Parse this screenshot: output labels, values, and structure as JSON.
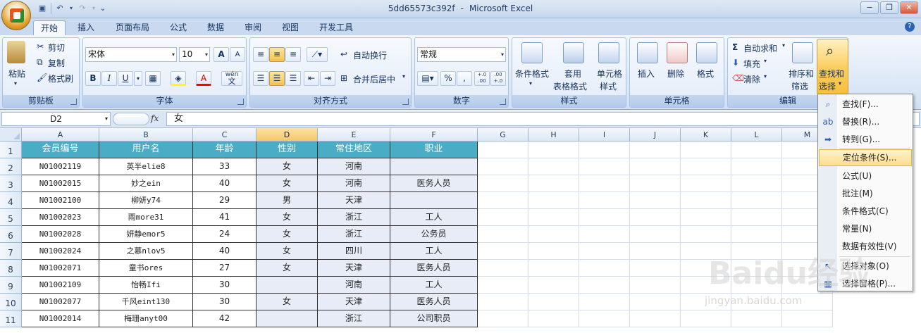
{
  "window": {
    "title": "5dd65573c392f - Microsoft Excel",
    "title_file": "5dd65573c392f",
    "title_sep": "-",
    "title_app": "Microsoft Excel",
    "min": "−",
    "max": "❐",
    "close": "✕"
  },
  "tabs": [
    "开始",
    "插入",
    "页面布局",
    "公式",
    "数据",
    "审阅",
    "视图",
    "开发工具"
  ],
  "active_tab": "开始",
  "ribbon": {
    "clipboard": {
      "label": "剪贴板",
      "paste": "粘贴",
      "cut": "剪切",
      "copy": "复制",
      "format_painter": "格式刷"
    },
    "font": {
      "label": "字体",
      "name": "宋体",
      "size": "10",
      "bold": "B",
      "italic": "I",
      "underline": "U",
      "grow": "A",
      "shrink": "A",
      "phonetic": "wén",
      "phonetic_char": "文"
    },
    "alignment": {
      "label": "对齐方式",
      "wrap": "自动换行",
      "merge": "合并后居中"
    },
    "number": {
      "label": "数字",
      "format": "常规",
      "percent": "%",
      "comma": ",",
      "dec_inc": "+.0 .00",
      "dec_dec": ".00 +.0"
    },
    "styles": {
      "label": "样式",
      "conditional": "条件格式",
      "table_1": "套用",
      "table_2": "表格格式",
      "cell_styles_1": "单元格",
      "cell_styles_2": "样式"
    },
    "cells": {
      "label": "单元格",
      "insert": "插入",
      "delete": "删除",
      "format": "格式"
    },
    "editing": {
      "label": "编辑",
      "autosum": "自动求和",
      "fill": "填充",
      "clear": "清除",
      "sort_1": "排序和",
      "sort_2": "筛选",
      "find_1": "查找和",
      "find_2": "选择"
    }
  },
  "formula_bar": {
    "name_box": "D2",
    "fx": "fx",
    "value": "女"
  },
  "columns": [
    "A",
    "B",
    "C",
    "D",
    "E",
    "F",
    "G",
    "H",
    "I",
    "J",
    "K",
    "L",
    "M"
  ],
  "row_numbers": [
    "1",
    "2",
    "3",
    "4",
    "5",
    "6",
    "7",
    "8",
    "9",
    "10",
    "11"
  ],
  "table": {
    "headers": [
      "会员编号",
      "用户名",
      "年龄",
      "性别",
      "常住地区",
      "职业"
    ],
    "rows": [
      [
        "N01002119",
        "英半elie8",
        "33",
        "女",
        "河南",
        ""
      ],
      [
        "N01002015",
        "妙之ein",
        "40",
        "女",
        "河南",
        "医务人员"
      ],
      [
        "N01002100",
        "柳妍y74",
        "29",
        "男",
        "天津",
        ""
      ],
      [
        "N01002023",
        "雨more31",
        "41",
        "女",
        "浙江",
        "工人"
      ],
      [
        "N01002028",
        "妍静emor5",
        "24",
        "女",
        "浙江",
        "公务员"
      ],
      [
        "N01002024",
        "之慕nlov5",
        "40",
        "女",
        "四川",
        "工人"
      ],
      [
        "N01002071",
        "童书ores",
        "27",
        "女",
        "天津",
        "医务人员"
      ],
      [
        "N01002109",
        "怡畅Ifi",
        "30",
        "",
        "河南",
        "工人"
      ],
      [
        "N01002077",
        "千风eint130",
        "30",
        "女",
        "天津",
        "医务人员"
      ],
      [
        "N01002014",
        "梅珊anyt00",
        "42",
        "",
        "浙江",
        "公司职员"
      ]
    ]
  },
  "find_menu": [
    {
      "label": "查找(F)...",
      "key": "F",
      "icon": "binoculars-icon",
      "glyph": "⌕"
    },
    {
      "label": "替换(R)...",
      "key": "R",
      "icon": "replace-icon",
      "glyph": "ab"
    },
    {
      "label": "转到(G)...",
      "key": "G",
      "icon": "arrow-right-icon",
      "glyph": "➡"
    },
    {
      "label": "定位条件(S)...",
      "key": "S",
      "icon": "",
      "glyph": ""
    },
    {
      "label": "公式(U)",
      "key": "U",
      "icon": "",
      "glyph": ""
    },
    {
      "label": "批注(M)",
      "key": "M",
      "icon": "",
      "glyph": ""
    },
    {
      "label": "条件格式(C)",
      "key": "C",
      "icon": "",
      "glyph": ""
    },
    {
      "label": "常量(N)",
      "key": "N",
      "icon": "",
      "glyph": ""
    },
    {
      "label": "数据有效性(V)",
      "key": "V",
      "icon": "",
      "glyph": ""
    },
    {
      "label": "选择对象(O)",
      "key": "O",
      "icon": "select-objects-icon",
      "glyph": "↖"
    },
    {
      "label": "选择窗格(P)...",
      "key": "P",
      "icon": "selection-pane-icon",
      "glyph": "▦"
    }
  ],
  "highlighted_menu_item": "定位条件(S)...",
  "watermark": {
    "brand": "Baidu经验",
    "url": "jingyan.baidu.com"
  },
  "colors": {
    "header_fill": "#4bacc6",
    "selection": "#e8ecf6",
    "menu_highlight": "#ffdd8c"
  }
}
